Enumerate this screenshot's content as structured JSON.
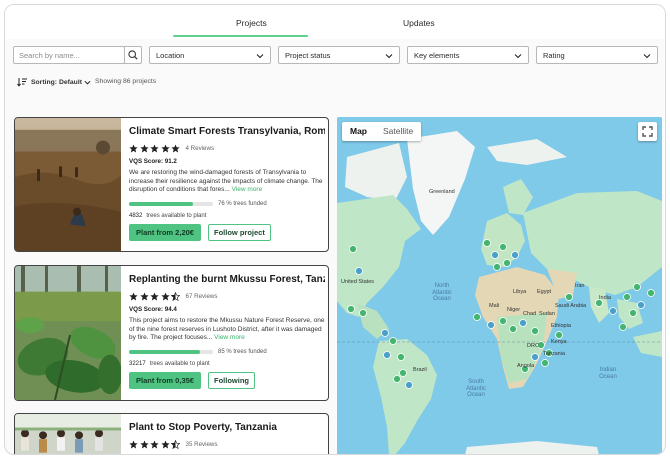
{
  "tabs": [
    {
      "label": "Projects",
      "active": true
    },
    {
      "label": "Updates",
      "active": false
    }
  ],
  "filters": {
    "search_placeholder": "Search by name...",
    "search_value": "",
    "location": "Location",
    "project_status": "Project status",
    "key_elements": "Key elements",
    "rating": "Rating"
  },
  "sorting": {
    "label": "Sorting:",
    "value": "Default",
    "showing": "Showing 86 projects"
  },
  "projects": [
    {
      "title": "Climate Smart Forests Transylvania, Roma...",
      "rating": 5,
      "reviews": "4 Reviews",
      "vqs": "VQS Score: 91.2",
      "description": "We are restoring the wind-damaged forests of Transylvania to increase their resilience against the impacts of climate change. The disruption of conditions that fores...",
      "view_more": "View more",
      "funded_pct": 76,
      "funded_label": "76 % trees funded",
      "trees_count": "4832",
      "trees_label": "trees available to plant",
      "plant_label": "Plant from 2,20€",
      "follow_label": "Follow project"
    },
    {
      "title": "Replanting the burnt Mkussu Forest, Tanza...",
      "rating": 4.5,
      "reviews": "67 Reviews",
      "vqs": "VQS Score: 94.4",
      "description": "This project aims to restore the Mkussu Nature Forest Reserve, one of the nine forest reserves in Lushoto District, after it was damaged by fire. The project focuses...",
      "view_more": "View more",
      "funded_pct": 85,
      "funded_label": "85 % trees funded",
      "trees_count": "32217",
      "trees_label": "trees available to plant",
      "plant_label": "Plant from 0,35€",
      "follow_label": "Following"
    },
    {
      "title": "Plant to Stop Poverty, Tanzania",
      "rating": 4.5,
      "reviews": "35 Reviews"
    }
  ],
  "map": {
    "map_label": "Map",
    "satellite_label": "Satellite",
    "places": {
      "greenland": "Greenland",
      "united_states": "United States",
      "north_atlantic": "North Atlantic Ocean",
      "south_atlantic": "South Atlantic Ocean",
      "indian": "Indian Ocean",
      "libya": "Libya",
      "egypt": "Egypt",
      "saudi": "Saudi Arabia",
      "iran": "Iran",
      "india": "India",
      "mali": "Mali",
      "niger": "Niger",
      "chad": "Chad",
      "sudan": "Sudan",
      "ethiopia": "Ethiopia",
      "drc": "DRC",
      "kenya": "Kenya",
      "angola": "Angola",
      "tanzania": "Tanzania",
      "brazil": "Brazil"
    }
  },
  "colors": {
    "accent": "#4fc482",
    "ocean": "#7fc9e9",
    "land": "#bfe6c6",
    "marker": "#44b56f",
    "marker_blue": "#4aa0c9"
  }
}
